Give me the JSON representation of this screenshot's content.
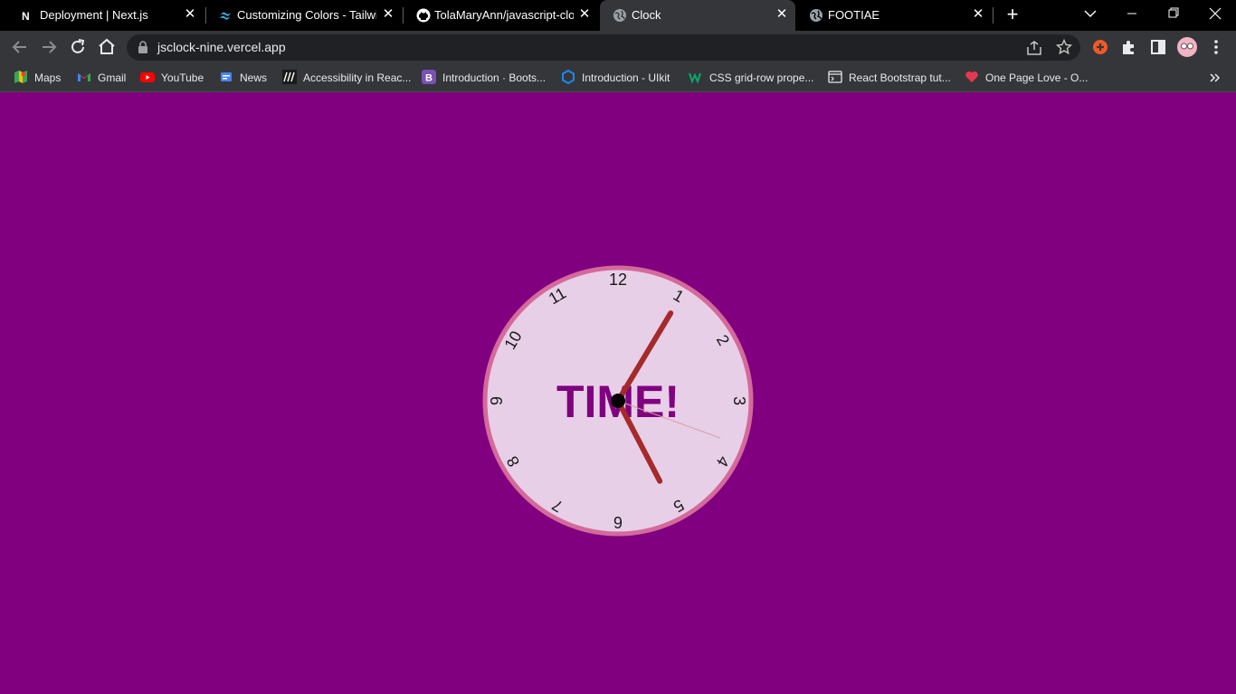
{
  "browser": {
    "tabs": [
      {
        "title": "Deployment | Next.js",
        "icon": "nextjs-logo-icon",
        "active": false
      },
      {
        "title": "Customizing Colors - Tailwind",
        "icon": "tailwind-logo-icon",
        "active": false
      },
      {
        "title": "TolaMaryAnn/javascript-clock",
        "icon": "github-logo-icon",
        "active": false
      },
      {
        "title": "Clock",
        "icon": "globe-icon",
        "active": true
      },
      {
        "title": "FOOTIAE",
        "icon": "globe-icon",
        "active": false
      }
    ],
    "address_bar": {
      "url": "jsclock-nine.vercel.app"
    },
    "bookmarks": [
      {
        "label": "Maps",
        "icon": "google-maps-icon"
      },
      {
        "label": "Gmail",
        "icon": "gmail-icon"
      },
      {
        "label": "YouTube",
        "icon": "youtube-icon"
      },
      {
        "label": "News",
        "icon": "google-news-icon"
      },
      {
        "label": "Accessibility in Reac...",
        "icon": "mdn-logo-icon"
      },
      {
        "label": "Introduction · Boots...",
        "icon": "bootstrap-logo-icon"
      },
      {
        "label": "Introduction - UIkit",
        "icon": "uikit-logo-icon"
      },
      {
        "label": "CSS grid-row prope...",
        "icon": "w3schools-logo-icon"
      },
      {
        "label": "React Bootstrap tut...",
        "icon": "terminal-icon"
      },
      {
        "label": "One Page Love - O...",
        "icon": "heart-icon"
      }
    ]
  },
  "clock": {
    "label": "TIME!",
    "numbers": [
      "12",
      "1",
      "2",
      "3",
      "4",
      "5",
      "6",
      "7",
      "8",
      "9",
      "10",
      "11"
    ],
    "time": {
      "hour": 5,
      "minute": 5,
      "second": 10
    },
    "colors": {
      "page_background": "#800080",
      "face": "#e8cfe8",
      "rim": "#d46a9a",
      "label": "#800080",
      "hands": "#a52a2a",
      "second_hand": "#d8a0a0",
      "center": "#000000"
    }
  }
}
